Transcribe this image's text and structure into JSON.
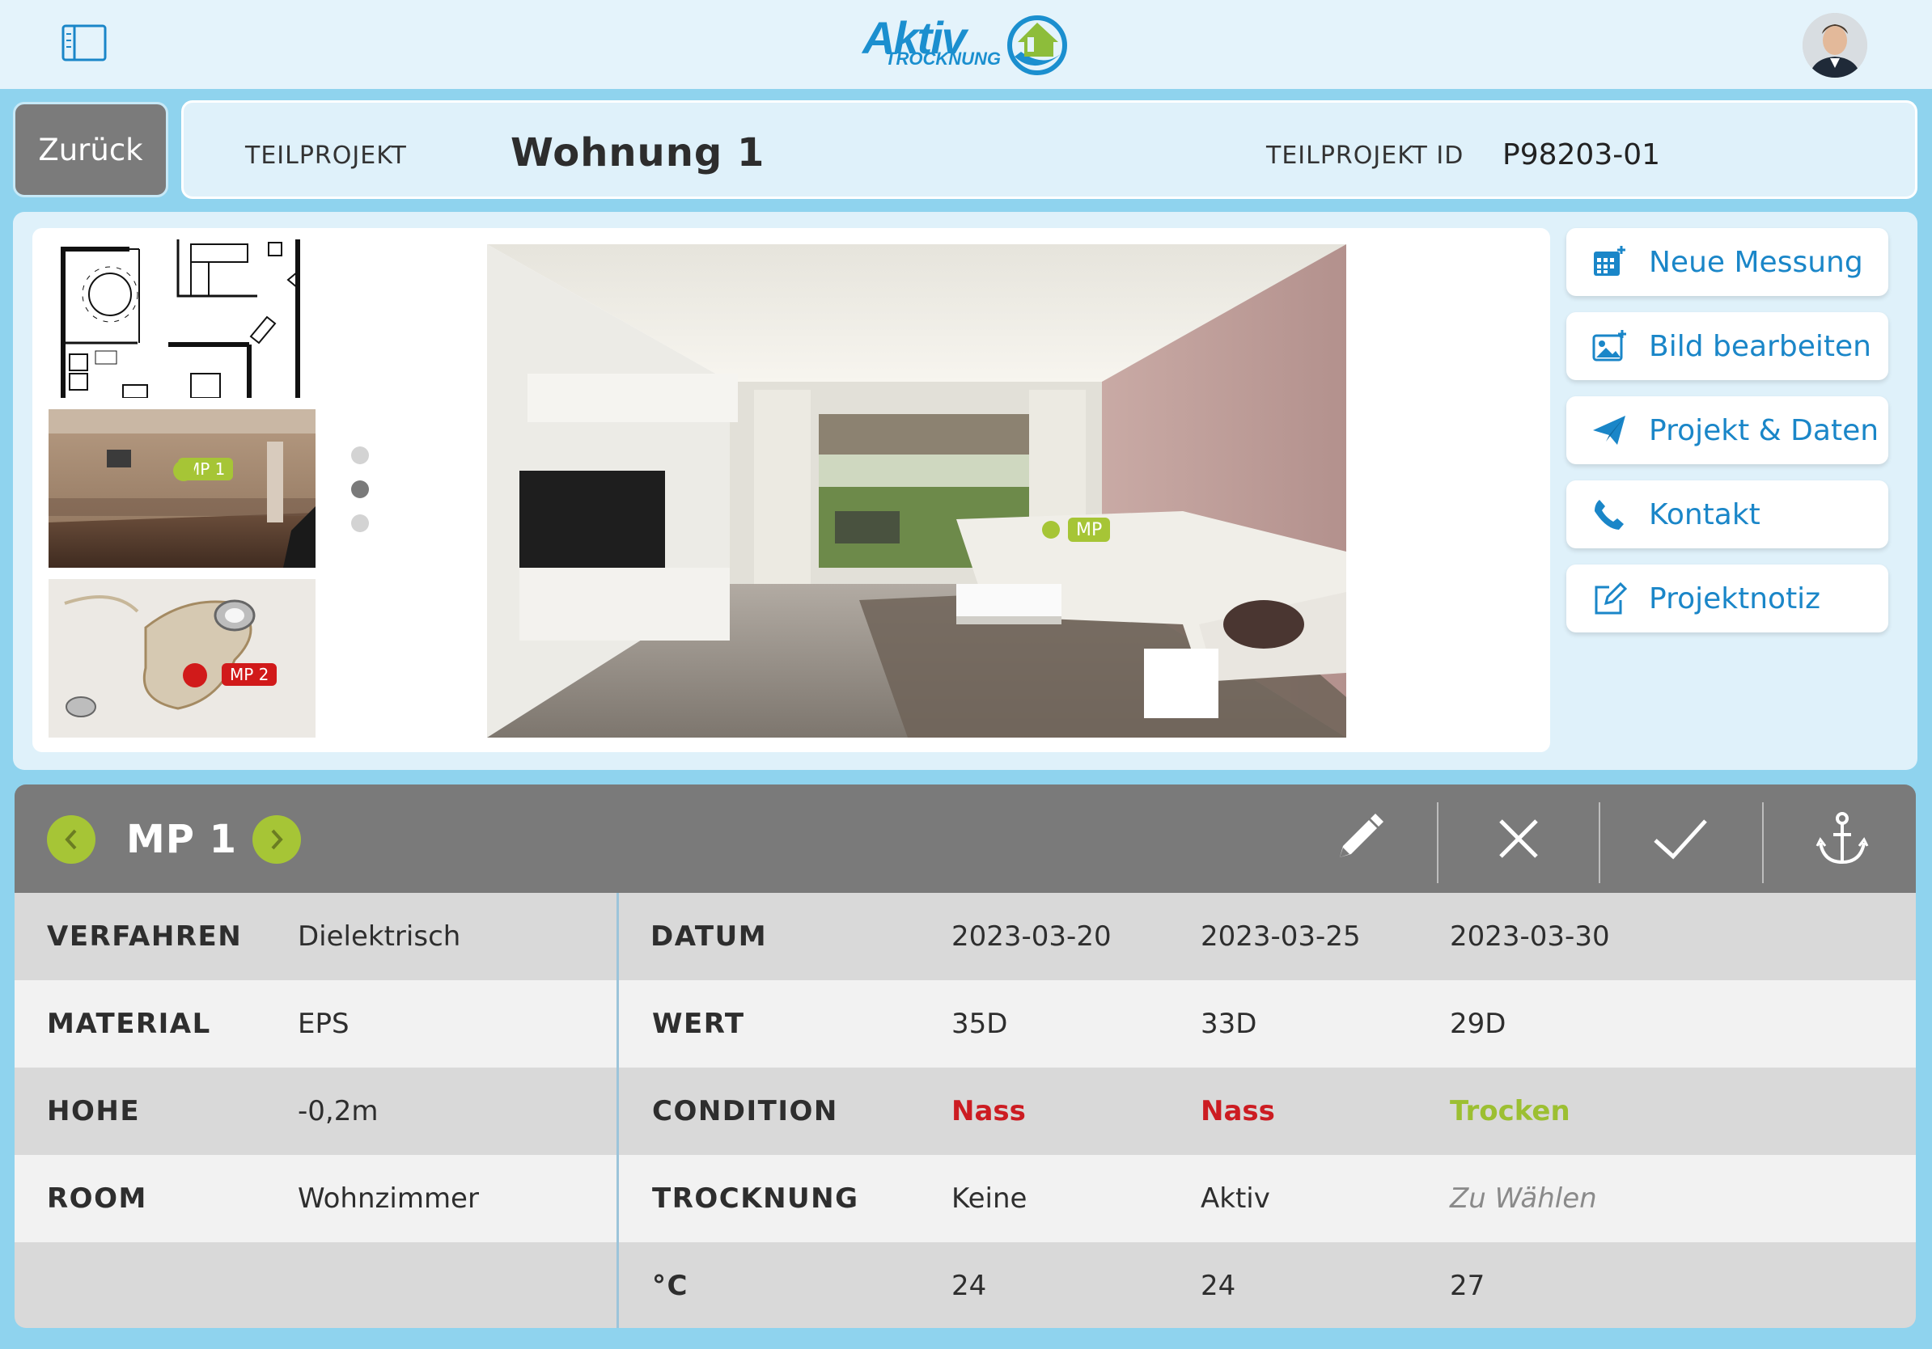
{
  "brand": {
    "name": "Aktiv",
    "sub": "TROCKNUNG"
  },
  "header": {
    "back_label": "Zurück"
  },
  "project": {
    "label": "TEILPROJEKT",
    "title": "Wohnung 1",
    "id_label": "TEILPROJEKT ID",
    "id_value": "P98203-01"
  },
  "thumbnails": [
    {
      "kind": "floor-plan"
    },
    {
      "kind": "basement",
      "marker": "MP 1",
      "marker_color": "#a6c536"
    },
    {
      "kind": "ceiling",
      "marker": "MP 2",
      "marker_color": "#d11a1a"
    }
  ],
  "carousel": {
    "dots": 3,
    "active_index": 1
  },
  "main_photo": {
    "marker": "MP",
    "marker_color": "#a6c536"
  },
  "actions": [
    {
      "label": "Neue Messung",
      "icon": "calendar-add-icon"
    },
    {
      "label": "Bild bearbeiten",
      "icon": "image-add-icon"
    },
    {
      "label": "Projekt & Daten",
      "icon": "send-icon"
    },
    {
      "label": "Kontakt",
      "icon": "phone-icon"
    },
    {
      "label": "Projektnotiz",
      "icon": "edit-note-icon"
    }
  ],
  "detail": {
    "title": "MP 1",
    "tools": [
      "pencil-icon",
      "close-icon",
      "check-icon",
      "anchor-icon"
    ],
    "left_rows": [
      {
        "key": "VERFAHREN",
        "value": "Dielektrisch"
      },
      {
        "key": "MATERIAL",
        "value": "EPS"
      },
      {
        "key": "HOHE",
        "value": "-0,2m"
      },
      {
        "key": "ROOM",
        "value": "Wohnzimmer"
      },
      {
        "key": "",
        "value": ""
      }
    ],
    "right_rows": [
      {
        "key": "DATUM",
        "values": [
          "2023-03-20",
          "2023-03-25",
          "2023-03-30"
        ]
      },
      {
        "key": "WERT",
        "values": [
          "35D",
          "33D",
          "29D"
        ]
      },
      {
        "key": "CONDITION",
        "values": [
          "Nass",
          "Nass",
          "Trocken"
        ]
      },
      {
        "key": "TROCKNUNG",
        "values": [
          "Keine",
          "Aktiv",
          "Zu Wählen"
        ]
      },
      {
        "key": "°C",
        "values": [
          "24",
          "24",
          "27"
        ]
      }
    ]
  },
  "colors": {
    "accent_blue": "#1a86c8",
    "accent_green": "#a6c536",
    "status_wet": "#cc1c22",
    "status_dry": "#9cbf32",
    "background": "#8fd3ee"
  }
}
